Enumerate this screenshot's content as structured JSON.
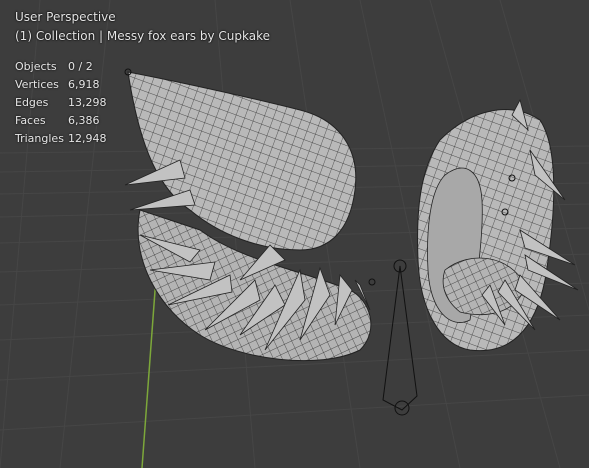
{
  "viewport": {
    "view_name": "User Perspective",
    "collection_label": "(1) Collection | Messy fox ears by Cupkake"
  },
  "statistics": [
    {
      "label": "Objects",
      "value": "0 / 2"
    },
    {
      "label": "Vertices",
      "value": "6,918"
    },
    {
      "label": "Edges",
      "value": "13,298"
    },
    {
      "label": "Faces",
      "value": "6,386"
    },
    {
      "label": "Triangles",
      "value": "12,948"
    }
  ],
  "colors": {
    "background": "#3d3d3d",
    "grid": "#474747",
    "y_axis": "#7da83a",
    "mesh_fill": "#b9b9b9",
    "wire": "#1a1a1a"
  }
}
